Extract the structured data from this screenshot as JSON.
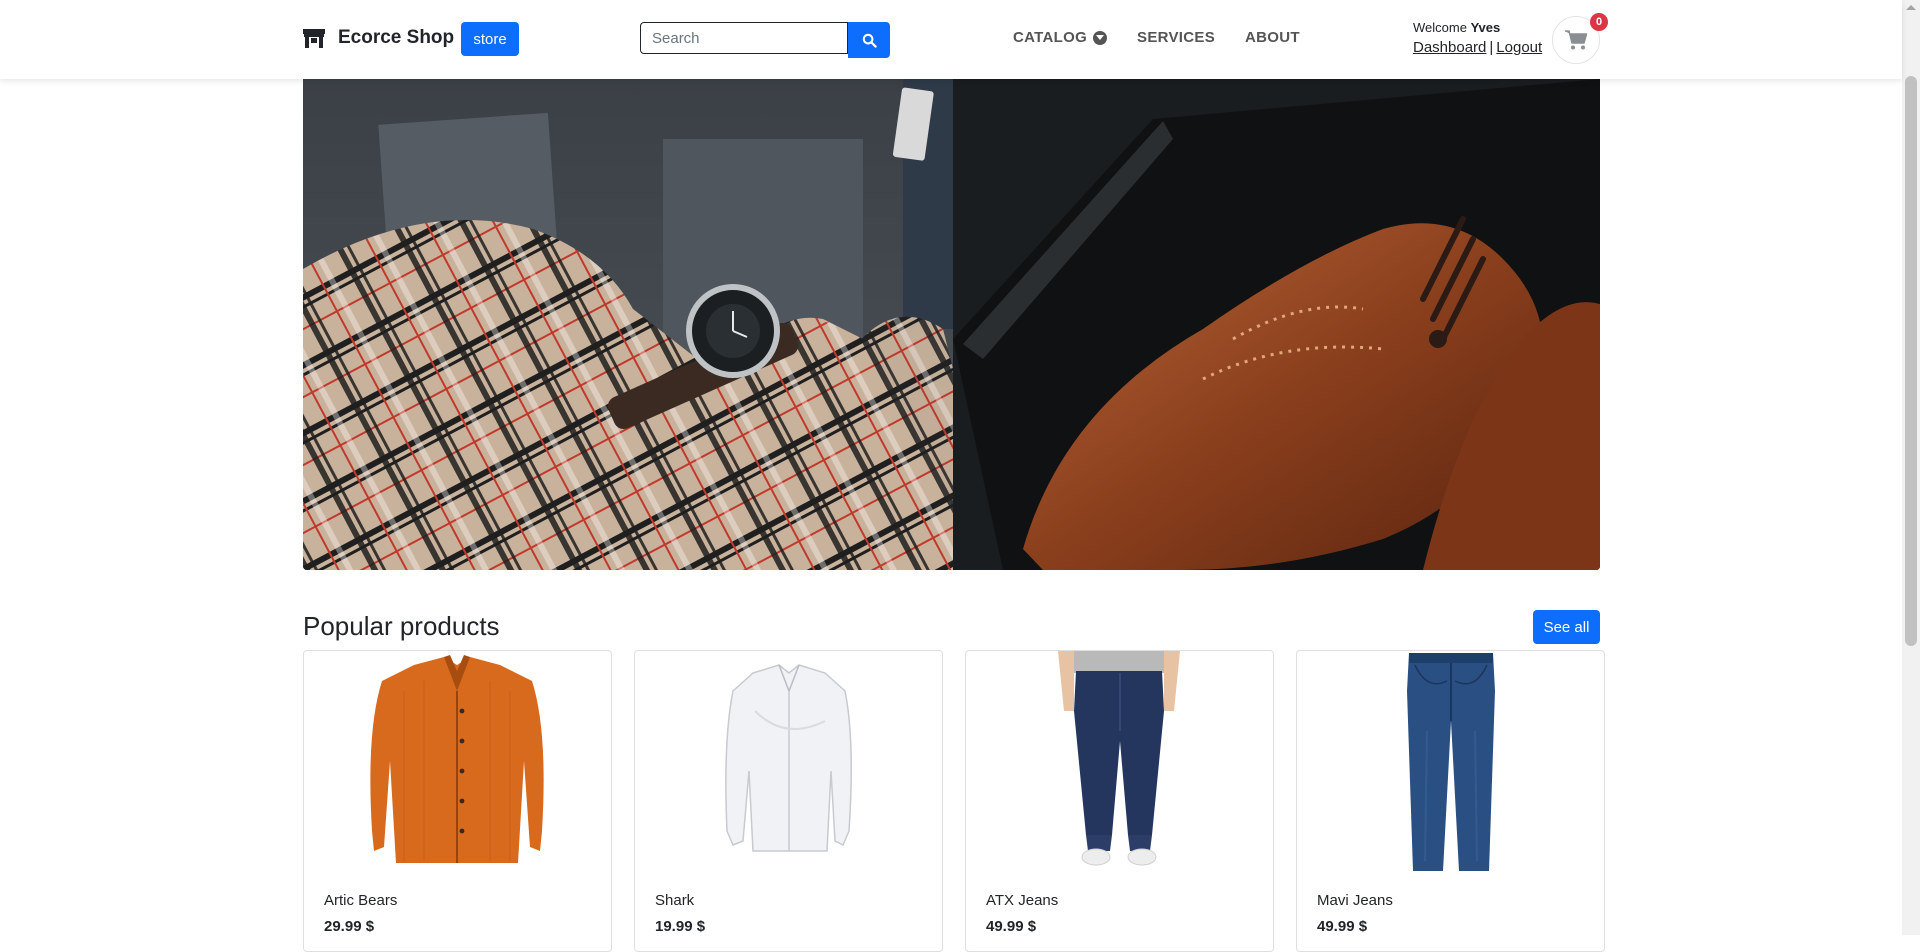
{
  "navbar": {
    "brand_name": "Ecorce Shop",
    "brand_icon": "storefront-icon",
    "store_button": "store",
    "search_placeholder": "Search",
    "search_icon": "search-icon",
    "links": [
      {
        "label": "CATALOG",
        "has_dropdown": true
      },
      {
        "label": "SERVICES",
        "has_dropdown": false
      },
      {
        "label": "ABOUT",
        "has_dropdown": false
      }
    ],
    "user": {
      "welcome": "Welcome",
      "name": "Yves",
      "dashboard": "Dashboard",
      "separator": "|",
      "logout": "Logout"
    },
    "cart": {
      "icon": "cart-icon",
      "count": "0"
    }
  },
  "hero": {
    "description_icon": "hero-banner-image"
  },
  "popular": {
    "title": "Popular products",
    "see_all": "See all",
    "products": [
      {
        "name": "Artic Bears",
        "price": "29.99 $"
      },
      {
        "name": "Shark",
        "price": "19.99 $"
      },
      {
        "name": "ATX Jeans",
        "price": "49.99 $"
      },
      {
        "name": "Mavi Jeans",
        "price": "49.99 $"
      }
    ]
  },
  "colors": {
    "primary": "#0d6efd",
    "badge": "#dc3545",
    "text": "#212529"
  }
}
